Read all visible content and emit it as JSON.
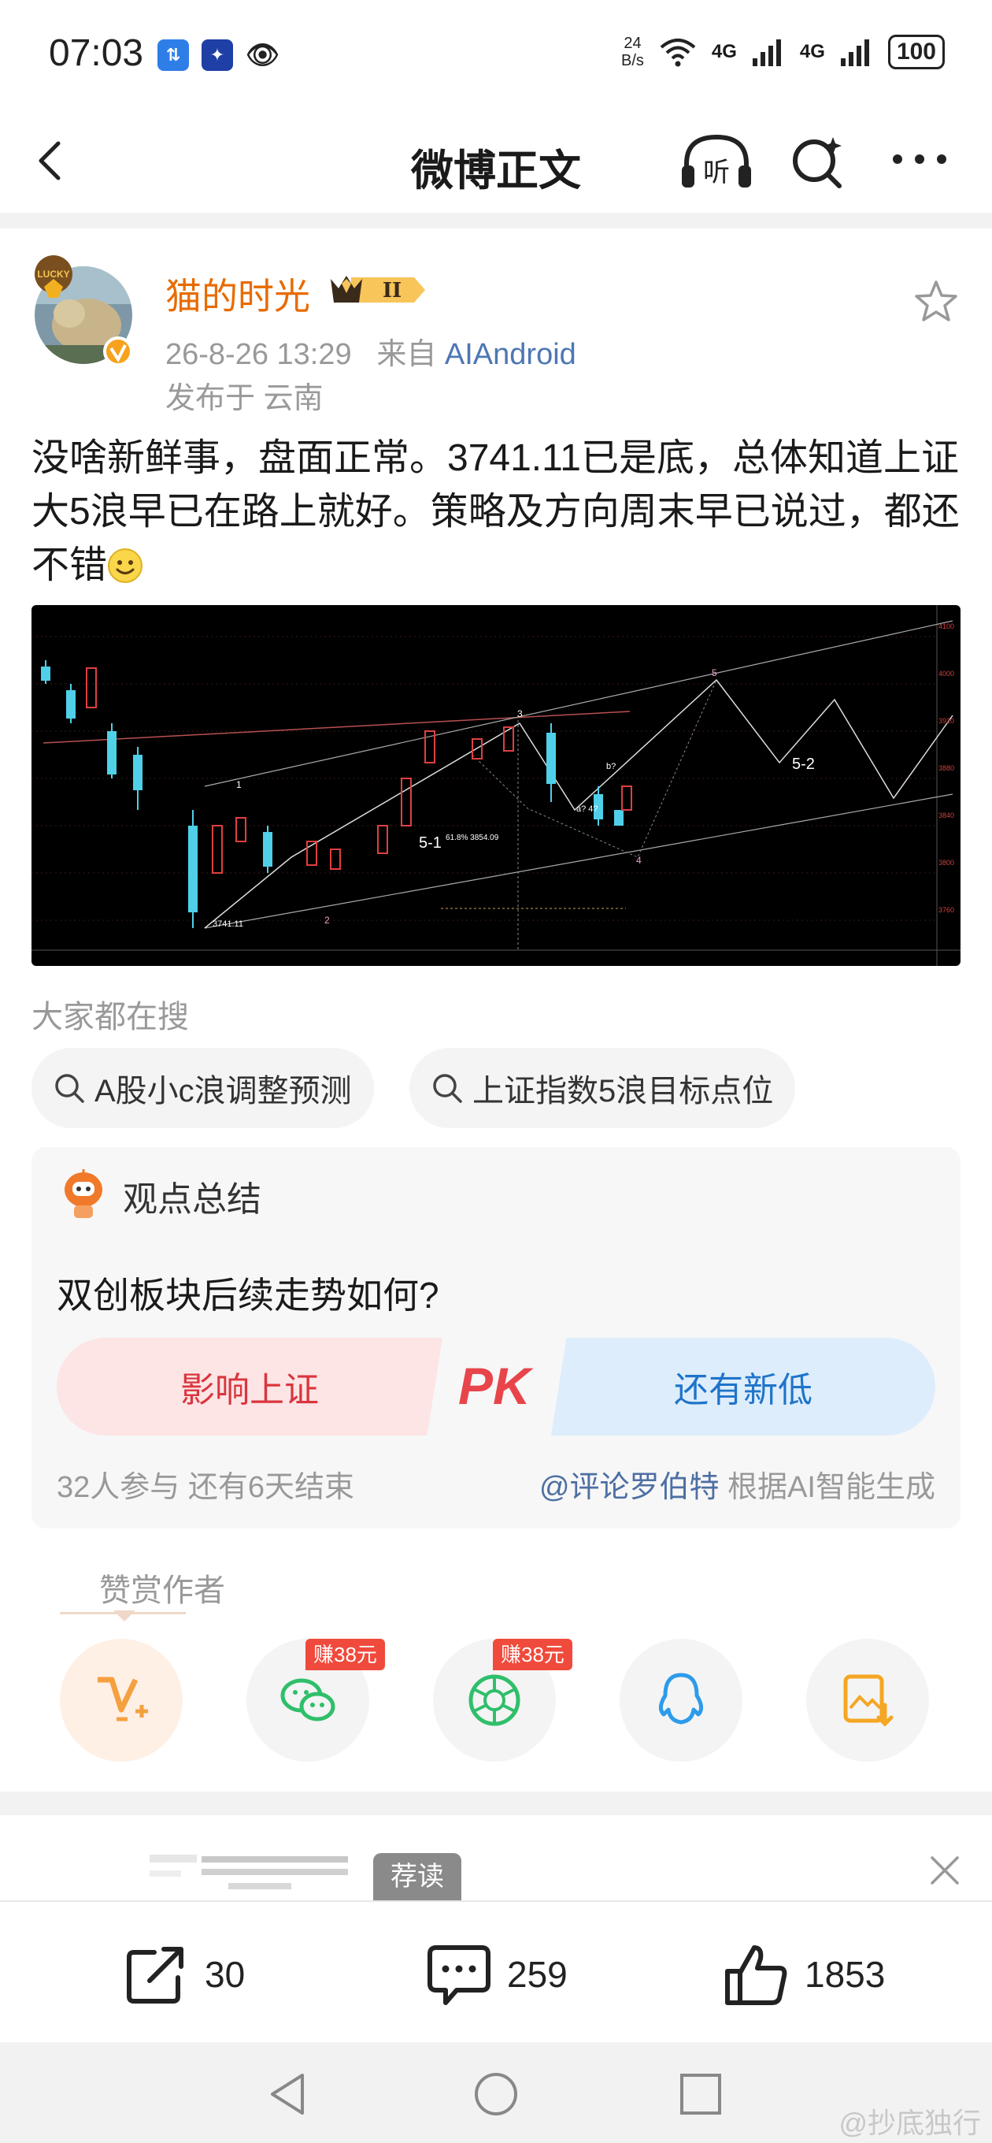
{
  "status_bar": {
    "time": "07:03",
    "app_icons": [
      "sync-icon",
      "atom-app-icon",
      "eye-icon"
    ],
    "net_speed_top": "24",
    "net_speed_bottom": "B/s",
    "signal1": "4G",
    "signal2": "4G",
    "battery": "100"
  },
  "header": {
    "title": "微博正文",
    "listen_label": "听"
  },
  "post": {
    "author": "猫的时光",
    "rank_badge": "II",
    "timestamp": "26-8-26 13:29",
    "source_prefix": "来自",
    "source": "AIAndroid",
    "location": "发布于 云南",
    "text": "没啥新鲜事，盘面正常。3741.11已是底，总体知道上证大5浪早已在路上就好。策略及方向周末早已说过，都还不错",
    "chart_labels": {
      "low": "3741.11",
      "wave5_1": "5-1",
      "wave5_2": "5-2",
      "fib": "61.8% 3854.09",
      "w1": "1",
      "w2": "2",
      "w3": "3",
      "w4": "4",
      "w5": "5",
      "b": "b?",
      "a4": "a? 4?"
    }
  },
  "everyone_search": {
    "heading": "大家都在搜",
    "chips": [
      "A股小c浪调整预测",
      "上证指数5浪目标点位"
    ]
  },
  "opinion": {
    "title": "观点总结",
    "question": "双创板块后续走势如何?",
    "left_option": "影响上证",
    "right_option": "还有新低",
    "pk": "PK",
    "stats": "32人参与  还有6天结束",
    "credit_at": "@评论罗伯特",
    "credit_suffix": " 根据AI智能生成"
  },
  "reward": {
    "label": "赞赏作者",
    "badges": [
      "赚38元",
      "赚38元"
    ],
    "icons": [
      "weibo-pay-icon",
      "wechat-icon",
      "moments-icon",
      "qq-icon",
      "save-image-icon"
    ]
  },
  "recommend": {
    "tag": "荐读"
  },
  "actions": {
    "repost": "30",
    "comment": "259",
    "like": "1853"
  },
  "watermark": "@抄底独行",
  "colors": {
    "author": "#e86b00",
    "link": "#4d77b3",
    "pk_red": "#d9363e",
    "pk_blue": "#1f74c9",
    "badge_red": "#f04a3c"
  }
}
